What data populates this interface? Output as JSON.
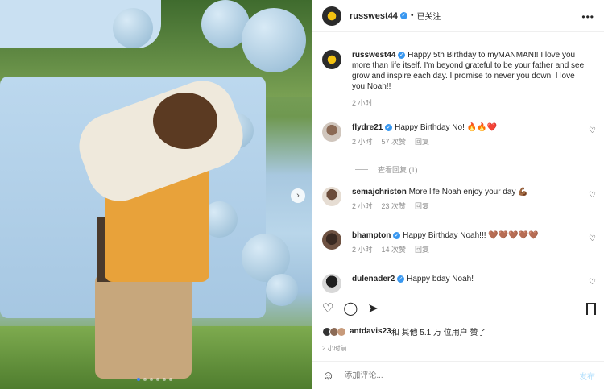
{
  "header": {
    "username": "russwest44",
    "separator": "•",
    "follow_status": "已关注",
    "more_label": "•••"
  },
  "caption": {
    "username": "russwest44",
    "text": "Happy 5th Birthday to myMANMAN!! I love you more than life itself. I'm beyond grateful to be your father and see grow and inspire each day. I promise to never you down! I love you Noah!!",
    "time": "2 小时"
  },
  "comments": [
    {
      "username": "flydre21",
      "text": "Happy Birthday No! 🔥🔥❤️",
      "time": "2 小时",
      "likes": "57 次赞",
      "reply": "回复"
    },
    {
      "username": "semajchriston",
      "text": "More life Noah enjoy your day 💪🏾",
      "time": "2 小时",
      "likes": "23 次赞",
      "reply": "回复"
    },
    {
      "username": "bhampton",
      "text": "Happy Birthday Noah!!! 🤎🤎🤎🤎🤎",
      "time": "2 小时",
      "likes": "14 次赞",
      "reply": "回复"
    },
    {
      "username": "dulenader2",
      "text": "Happy bday Noah!"
    }
  ],
  "view_replies": "查看回复 (1)",
  "likes_line": {
    "user": "antdavis23",
    "text": " 和 其他 5.1 万 位用户 赞了"
  },
  "post_time": "2 小时前",
  "composer": {
    "placeholder": "添加评论...",
    "post_label": "发布"
  },
  "icons": [
    "heart-icon",
    "comment-icon",
    "share-icon",
    "bookmark-icon",
    "emoji-icon",
    "more-icon"
  ],
  "colors": {
    "verified": "#3897f0",
    "muted": "#8e8e8e",
    "carousel_active": "#3b82f6"
  }
}
